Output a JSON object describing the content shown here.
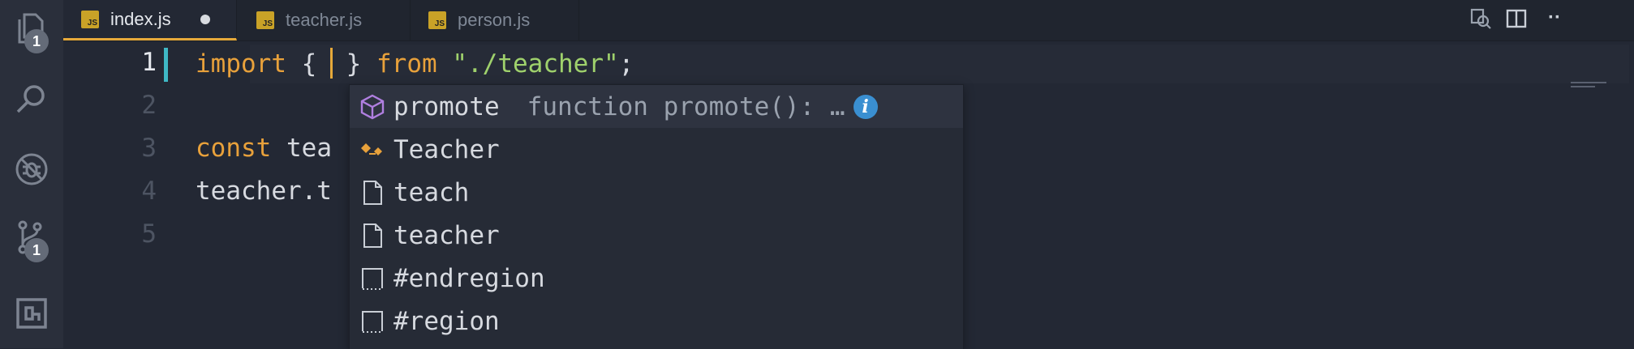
{
  "activity_bar": {
    "explorer_badge": "1",
    "scm_badge": "1"
  },
  "tabs": [
    {
      "label": "index.js",
      "icon": "JS",
      "active": true,
      "modified": true
    },
    {
      "label": "teacher.js",
      "icon": "JS",
      "active": false,
      "modified": false
    },
    {
      "label": "person.js",
      "icon": "JS",
      "active": false,
      "modified": false
    }
  ],
  "editor": {
    "line_numbers": [
      "1",
      "2",
      "3",
      "4",
      "5"
    ],
    "active_line": 1,
    "line1": {
      "kw_import": "import",
      "brace_open": "{",
      "brace_close": "}",
      "kw_from": "from",
      "string": "\"./teacher\"",
      "semicolon": ";"
    },
    "line3": {
      "kw_const": "const",
      "ident": "tea"
    },
    "line4": {
      "text": "teacher.t"
    }
  },
  "suggest": {
    "items": [
      {
        "label": "promote",
        "detail": "function promote(): …",
        "kind": "module-icon",
        "selected": true
      },
      {
        "label": "Teacher",
        "detail": "",
        "kind": "class-icon",
        "selected": false
      },
      {
        "label": "teach",
        "detail": "",
        "kind": "file-icon",
        "selected": false
      },
      {
        "label": "teacher",
        "detail": "",
        "kind": "file-icon",
        "selected": false
      },
      {
        "label": "#endregion",
        "detail": "",
        "kind": "snippet-icon",
        "selected": false
      },
      {
        "label": "#region",
        "detail": "",
        "kind": "snippet-icon",
        "selected": false
      }
    ],
    "info_glyph": "i"
  },
  "colors": {
    "keyword": "#e8a13b",
    "string": "#9fd16c",
    "accent": "#3fb8c5",
    "tab_border": "#e6a93a"
  }
}
